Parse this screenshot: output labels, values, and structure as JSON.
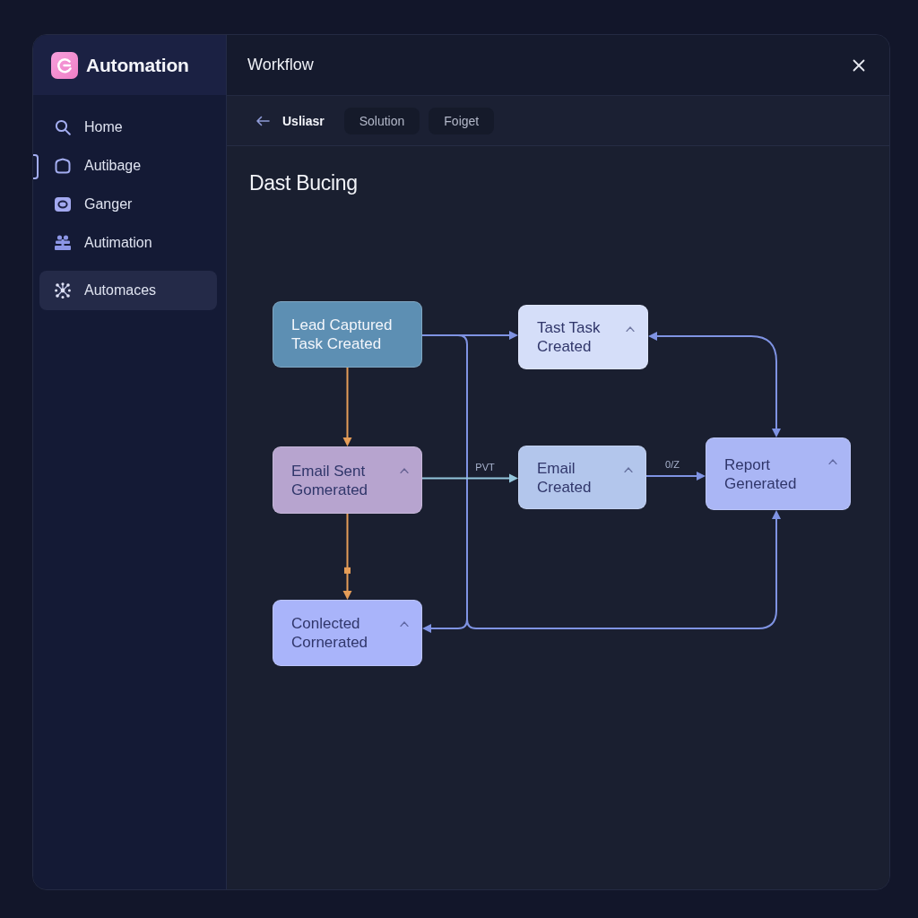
{
  "sidebar": {
    "brand": "Automation",
    "items": [
      {
        "label": "Home",
        "selected": false,
        "current": false
      },
      {
        "label": "Autibage",
        "selected": false,
        "current": true
      },
      {
        "label": "Ganger",
        "selected": false,
        "current": false
      },
      {
        "label": "Autimation",
        "selected": false,
        "current": false
      },
      {
        "label": "Automaces",
        "selected": true,
        "current": false
      }
    ]
  },
  "header": {
    "title": "Workflow"
  },
  "tabs": [
    {
      "label": "Usliasr",
      "selected": true
    },
    {
      "label": "Solution",
      "selected": false
    },
    {
      "label": "Foiget",
      "selected": false
    }
  ],
  "heading": "Dast Bucing",
  "diagram": {
    "nodes": [
      {
        "title": "Lead Captured",
        "subtitle": "Task Created",
        "color": "#5d8fb3",
        "caret": false
      },
      {
        "title": "Tast Task",
        "subtitle": "Created",
        "color": "#d5def9",
        "caret": true
      },
      {
        "title": "Email Sent",
        "subtitle": "Gomerated",
        "color": "#b7a4cf",
        "caret": true
      },
      {
        "title": "Email",
        "subtitle": "Created",
        "color": "#b3c6ec",
        "caret": true
      },
      {
        "title": "Report",
        "subtitle": "Generated",
        "color": "#aab6f5",
        "caret": true
      },
      {
        "title": "Conlected",
        "subtitle": "Cornerated",
        "color": "#a9b4fa",
        "caret": true
      }
    ],
    "edges": [
      {
        "color": "#e59d58",
        "handle": false,
        "bidirectional": false
      },
      {
        "color": "#e59d58",
        "handle": true,
        "bidirectional": false
      },
      {
        "color": "#7f93e3",
        "handle": false,
        "bidirectional": false
      },
      {
        "color": "#7f93e3",
        "handle": false,
        "bidirectional": false
      },
      {
        "color": "#7f93e3",
        "handle": false,
        "bidirectional": false
      },
      {
        "color": "#94c6dc",
        "label": "PVT",
        "handle": false,
        "bidirectional": false
      },
      {
        "color": "#7f93e3",
        "label": "0/Z",
        "handle": false,
        "bidirectional": false
      },
      {
        "color": "#7f93e3",
        "handle": false,
        "bidirectional": true
      }
    ]
  }
}
